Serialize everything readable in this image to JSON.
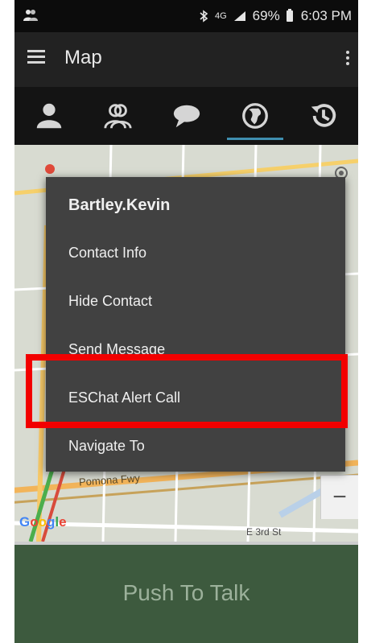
{
  "status_bar": {
    "left_icon": "people-icon",
    "bluetooth_icon": "bluetooth-icon",
    "network": "4G",
    "signal_icon": "signal-icon",
    "battery_percent": "69%",
    "time": "6:03 PM"
  },
  "app_bar": {
    "title": "Map",
    "menu_icon": "hamburger-icon",
    "more_icon": "overflow-menu-icon"
  },
  "tabs": [
    {
      "name": "contact",
      "icon": "person-icon",
      "selected": false
    },
    {
      "name": "groups",
      "icon": "group-icon",
      "selected": false
    },
    {
      "name": "messages",
      "icon": "chat-bubble-icon",
      "selected": false
    },
    {
      "name": "map",
      "icon": "globe-icon",
      "selected": true
    },
    {
      "name": "history",
      "icon": "history-icon",
      "selected": false
    }
  ],
  "map": {
    "road_label_1": "Pomona Fwy",
    "road_label_2": "E 3rd St",
    "google_logo": "Google"
  },
  "popup": {
    "title": "Bartley.Kevin",
    "items": [
      {
        "label": "Contact Info"
      },
      {
        "label": "Hide Contact"
      },
      {
        "label": "Send Message"
      },
      {
        "label": "ESChat Alert Call",
        "highlighted": true
      },
      {
        "label": "Navigate To"
      }
    ]
  },
  "bottom": {
    "push_to_talk": "Push To Talk"
  },
  "colors": {
    "accent": "#3f8fb0",
    "highlight_red": "#f20000",
    "ptt_green": "#3d5a3e",
    "popup_bg": "#414141"
  }
}
